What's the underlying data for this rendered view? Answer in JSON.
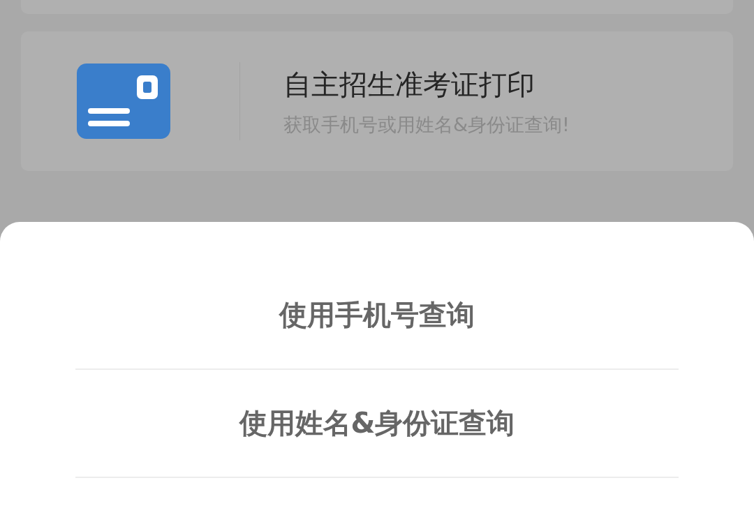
{
  "card": {
    "title": "自主招生准考证打印",
    "subtitle": "获取手机号或用姓名&身份证查询!"
  },
  "sheet": {
    "options": [
      {
        "label": "使用手机号查询"
      },
      {
        "label": "使用姓名&身份证查询"
      }
    ]
  }
}
